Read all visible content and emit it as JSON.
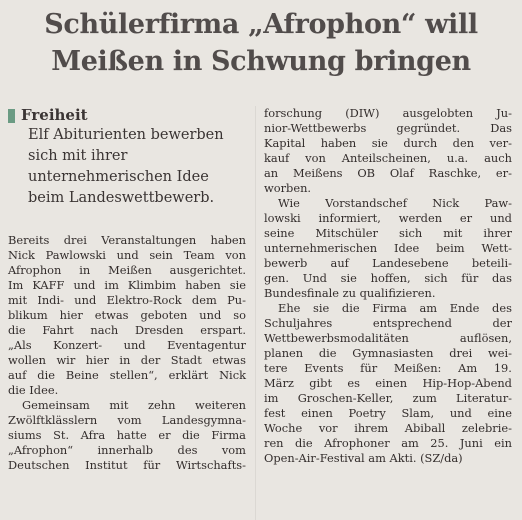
{
  "headline": {
    "line1": "Schülerfirma „Afrophon“ will",
    "line2": "Meißen in Schwung bringen"
  },
  "kicker": "Freiheit",
  "subhead": [
    "Elf Abiturienten bewerben",
    "sich mit ihrer",
    "unternehmerischen Idee",
    "beim Landeswettbewerb."
  ],
  "left_body": [
    "Bereits drei Veranstaltungen haben",
    "Nick Pawlowski und sein Team von",
    "Afrophon in Meißen ausgerichtet.",
    "Im KAFF und im Klimbim haben sie",
    "mit Indi- und Elektro-Rock dem Pu-",
    "blikum hier etwas geboten und so",
    "die Fahrt nach Dresden erspart.",
    "„Als Konzert- und Eventagentur",
    "wollen wir hier in der Stadt etwas",
    "auf die Beine stellen“, erklärt Nick",
    "die Idee.",
    "Gemeinsam mit zehn weiteren",
    "Zwölftklässlern vom Landesgymna-",
    "siums St. Afra hatte er die Firma",
    "„Afrophon“ innerhalb des vom",
    "Deutschen Institut für Wirtschafts-"
  ],
  "right_body": [
    "forschung (DIW) ausgelobten Ju-",
    "nior-Wettbewerbs gegründet. Das",
    "Kapital haben sie durch den ver-",
    "kauf von Anteilscheinen, u.a. auch",
    "an Meißens OB Olaf Raschke, er-",
    "worben.",
    "Wie Vorstandschef Nick Paw-",
    "lowski informiert, werden er und",
    "seine Mitschüler sich mit ihrer",
    "unternehmerischen Idee beim Wett-",
    "bewerb auf Landesebene beteili-",
    "gen. Und sie hoffen, sich für das",
    "Bundesfinale zu qualifizieren.",
    "Ehe sie die Firma am Ende des",
    "Schuljahres entsprechend der",
    "Wettbewerbsmodalitäten auflösen,",
    "planen die Gymnasiasten drei wei-",
    "tere Events für Meißen: Am 19.",
    "März gibt es einen Hip-Hop-Abend",
    "im Groschen-Keller, zum Literatur-",
    "fest einen Poetry Slam, und eine",
    "Woche vor ihrem Abiball zelebrie-",
    "ren die Afrophoner am 25. Juni ein",
    "Open-Air-Festival am Akti. (SZ/da)"
  ]
}
